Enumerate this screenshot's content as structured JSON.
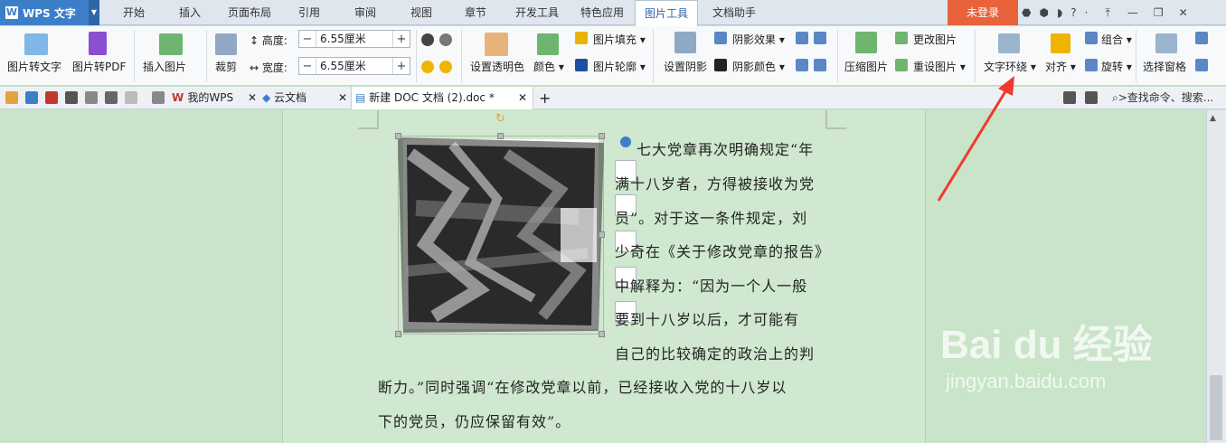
{
  "app": {
    "name": "WPS 文字",
    "login": "未登录"
  },
  "menu": {
    "tabs": [
      "开始",
      "插入",
      "页面布局",
      "引用",
      "审阅",
      "视图",
      "章节",
      "开发工具",
      "特色应用",
      "图片工具",
      "文档助手"
    ]
  },
  "ribbon": {
    "pic_to_text": "图片转文字",
    "pic_to_pdf": "图片转PDF",
    "insert_pic": "插入图片",
    "crop": "裁剪",
    "height_label": "高度:",
    "height_value": "6.55厘米",
    "width_label": "宽度:",
    "width_value": "6.55厘米",
    "set_transparent": "设置透明色",
    "color": "颜色",
    "pic_fill": "图片填充",
    "pic_outline": "图片轮廓",
    "set_shadow": "设置阴影",
    "shadow_effect": "阴影效果",
    "shadow_color": "阴影颜色",
    "compress": "压缩图片",
    "change_pic": "更改图片",
    "reset_pic": "重设图片",
    "text_wrap": "文字环绕",
    "align": "对齐",
    "group": "组合",
    "rotate": "旋转",
    "select_pane": "选择窗格"
  },
  "tabs": {
    "my_wps": "我的WPS",
    "cloud": "云文档",
    "doc": "新建 DOC 文档 (2).doc *",
    "search": ">查找命令、搜索..."
  },
  "document": {
    "lines": [
      "七大党章再次明确规定“年",
      "满十八岁者，方得被接收为党",
      "员”。对于这一条件规定，刘",
      "少奇在《关于修改党章的报告》",
      "中解释为：“因为一个人一般",
      "要到十八岁以后，才可能有",
      "自己的比较确定的政治上的判",
      "断力。”同时强调“在修改党章以前，已经接收入党的十八岁以",
      "下的党员，仍应保留有效”。"
    ]
  },
  "watermark": {
    "brand": "Bai du 经验",
    "url": "jingyan.baidu.com"
  }
}
